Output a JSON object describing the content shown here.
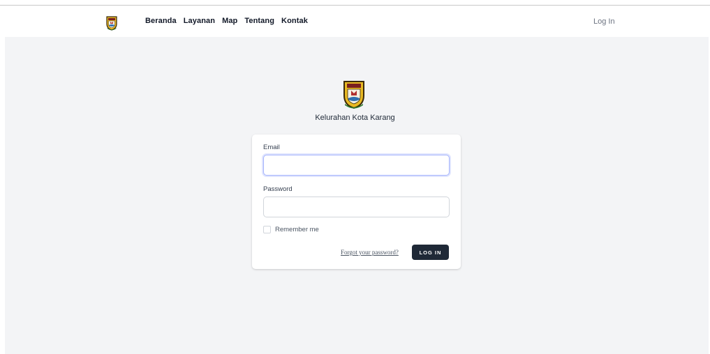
{
  "nav": {
    "links": [
      {
        "label": "Beranda"
      },
      {
        "label": "Layanan"
      },
      {
        "label": "Map"
      },
      {
        "label": "Tentang"
      },
      {
        "label": "Kontak"
      }
    ],
    "login_label": "Log In"
  },
  "brand": {
    "name": "Kelurahan Kota Karang"
  },
  "form": {
    "email_label": "Email",
    "email_value": "",
    "password_label": "Password",
    "password_value": "",
    "remember_label": "Remember me",
    "forgot_label": "Forgot your password?",
    "submit_label": "LOG IN"
  },
  "colors": {
    "background": "#f3f4f6",
    "button": "#1f2937",
    "focus_ring": "#a5b4fc",
    "emblem_gold": "#e8b923"
  },
  "icons": {
    "logo": "city-emblem-icon"
  }
}
